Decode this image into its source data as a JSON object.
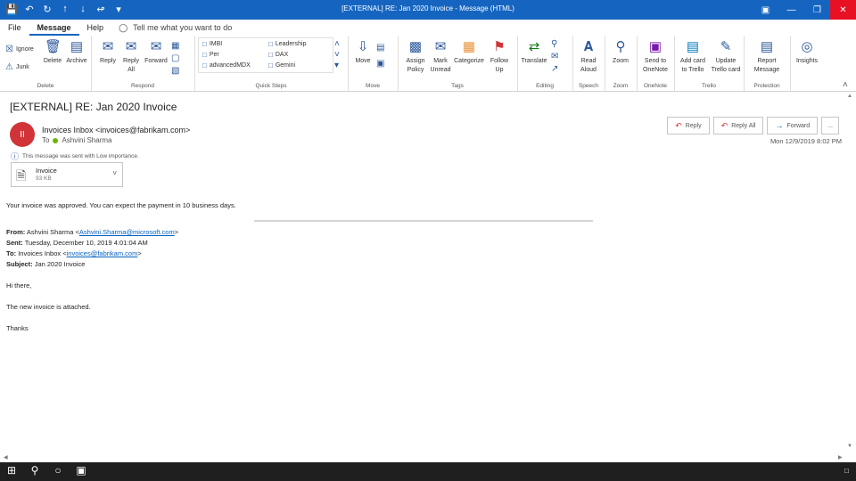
{
  "window": {
    "title": "[EXTERNAL] RE: Jan 2020 Invoice - Message (HTML)",
    "qat_icons": [
      "save-icon",
      "undo-icon",
      "redo-icon",
      "up-arrow-icon",
      "down-arrow-icon",
      "attach-icon",
      "customize-icon"
    ]
  },
  "tabs": {
    "file": "File",
    "message": "Message",
    "help": "Help",
    "tellme": "Tell me what you want to do"
  },
  "ribbon": {
    "delete": {
      "ignore": "Ignore",
      "junk": "Junk",
      "delete": "Delete",
      "archive": "Archive",
      "label": "Delete"
    },
    "respond": {
      "reply": "Reply",
      "reply_all_1": "Reply",
      "reply_all_2": "All",
      "forward": "Forward",
      "label": "Respond"
    },
    "quicksteps": {
      "items": [
        "IMBI",
        "Per",
        "advancedMDX",
        "Leadership",
        "DAX",
        "Gemini"
      ],
      "label": "Quick Steps"
    },
    "move": {
      "move": "Move",
      "label": "Move"
    },
    "tags": {
      "assign_1": "Assign",
      "assign_2": "Policy",
      "mark_1": "Mark",
      "mark_2": "Unread",
      "categorize": "Categorize",
      "follow_1": "Follow",
      "follow_2": "Up",
      "label": "Tags"
    },
    "editing": {
      "translate": "Translate",
      "label": "Editing"
    },
    "speech": {
      "read_1": "Read",
      "read_2": "Aloud",
      "label": "Speech"
    },
    "zoom": {
      "zoom": "Zoom",
      "label": "Zoom"
    },
    "onenote": {
      "send_1": "Send to",
      "send_2": "OneNote",
      "label": "OneNote"
    },
    "trello": {
      "add_1": "Add card",
      "add_2": "to Trello",
      "update_1": "Update",
      "update_2": "Trello card",
      "label": "Trello"
    },
    "protection": {
      "report_1": "Report",
      "report_2": "Message",
      "label": "Protection"
    },
    "insights": {
      "insights": "Insights"
    }
  },
  "message": {
    "subject": "[EXTERNAL] RE: Jan 2020 Invoice",
    "avatar_initials": "II",
    "sender": "Invoices Inbox <invoices@fabrikam.com>",
    "to_label": "To",
    "to_name": "Ashvini Sharma",
    "reply": "Reply",
    "reply_all": "Reply All",
    "forward": "Forward",
    "more": "...",
    "date": "Mon 12/9/2019 8:02 PM",
    "info": "This message was sent with Low importance.",
    "attachment": {
      "name": "Invoice",
      "size": "93 KB"
    },
    "body_line": "Your invoice was approved. You can expect the payment in 10 business days.",
    "from_label": "From:",
    "from_name": "Ashvini Sharma <",
    "from_email": "Ashvini.Sharma@microsoft.com",
    "from_end": ">",
    "sent_label": "Sent:",
    "sent_value": "Tuesday, December 10, 2019 4:01:04 AM",
    "to2_label": "To:",
    "to2_name": "Invoices Inbox <",
    "to2_email": "invoices@fabrikam.com",
    "to2_end": ">",
    "subj_label": "Subject:",
    "subj_value": "Jan 2020 Invoice",
    "greeting": "Hi there,",
    "line2": "The new invoice is attached.",
    "thanks": "Thanks"
  }
}
